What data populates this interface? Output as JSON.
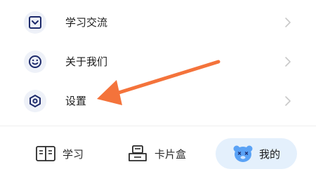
{
  "menu": {
    "items": [
      {
        "label": "学习交流",
        "icon": "inbox-icon"
      },
      {
        "label": "关于我们",
        "icon": "smiley-icon"
      },
      {
        "label": "设置",
        "icon": "settings-hexagon-icon"
      }
    ]
  },
  "tabbar": {
    "tabs": [
      {
        "label": "学习",
        "icon": "book-icon",
        "active": false
      },
      {
        "label": "卡片盒",
        "icon": "card-box-icon",
        "active": false
      },
      {
        "label": "我的",
        "icon": "bear-avatar-icon",
        "active": true
      }
    ]
  },
  "annotation": {
    "type": "arrow",
    "color": "#f4733b"
  },
  "colors": {
    "icon_stroke": "#1d2a6b",
    "icon_bg": "#eef1f8",
    "active_tab_bg": "#e4f0fc",
    "avatar": "#5aa2f5",
    "chevron": "#c8c8c8"
  }
}
